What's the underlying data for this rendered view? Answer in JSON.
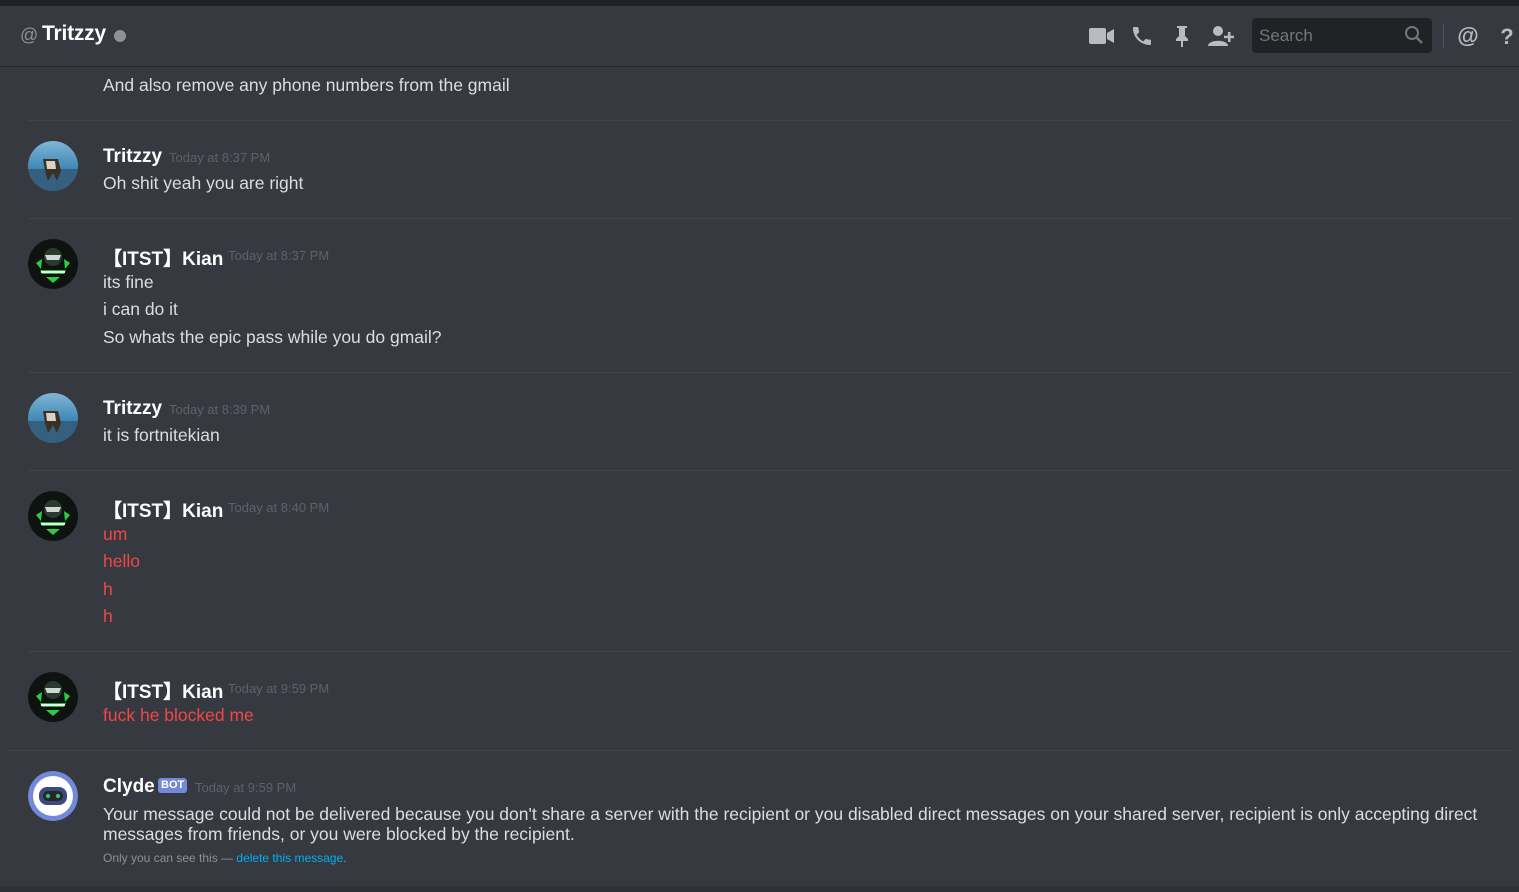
{
  "header": {
    "at_symbol": "@",
    "title": "Tritzzy",
    "search_placeholder": "Search",
    "icons": [
      "video-call-icon",
      "voice-call-icon",
      "pin-icon",
      "add-friend-icon",
      "search-icon",
      "mentions-icon",
      "help-icon"
    ]
  },
  "messages": {
    "cont_line": "And also remove any phone numbers from the gmail",
    "m1": {
      "author": "Tritzzy",
      "timestamp": "Today at 8:37 PM",
      "lines": [
        "Oh shit yeah you are right"
      ]
    },
    "m2": {
      "author": "【ITST】Kian",
      "timestamp": "Today at 8:37 PM",
      "lines": [
        "its fine",
        "i can do it",
        "So whats the epic pass while you do gmail?"
      ]
    },
    "m3": {
      "author": "Tritzzy",
      "timestamp": "Today at 8:39 PM",
      "lines": [
        "it is fortnitekian"
      ]
    },
    "m4": {
      "author": "【ITST】Kian",
      "timestamp": "Today at 8:40 PM",
      "lines": [
        "um",
        "hello",
        "h",
        "h"
      ]
    },
    "m5": {
      "author": "【ITST】Kian",
      "timestamp": "Today at 9:59 PM",
      "lines": [
        "fuck he blocked me"
      ]
    },
    "m6": {
      "author": "Clyde",
      "badge": "BOT",
      "timestamp": "Today at 9:59 PM",
      "text": "Your message could not be delivered because you don't share a server with the recipient or you disabled direct messages on your shared server, recipient is only accepting direct messages from friends, or you were blocked by the recipient.",
      "ephemeral_prefix": "Only you can see this — ",
      "ephemeral_link": "delete this message",
      "ephemeral_suffix": "."
    }
  },
  "colors": {
    "background": "#36393f",
    "failed_message": "#f04747",
    "bot_badge": "#7289da",
    "link": "#00b0f4"
  }
}
